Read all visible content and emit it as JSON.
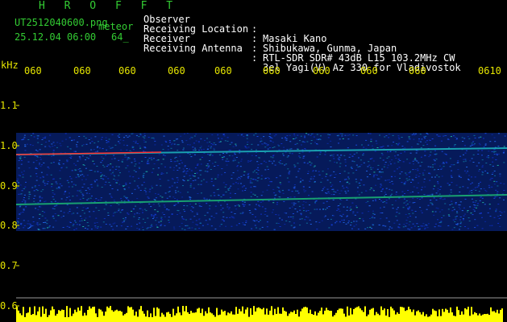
{
  "header": {
    "station_code": "H R O F F T",
    "filename": "UT2512040600.png",
    "mode": "meteor",
    "datetime": "25.12.04 06:00",
    "count": "64_"
  },
  "info": [
    {
      "label": "Observer",
      "sep": ":",
      "value": "Masaki Kano"
    },
    {
      "label": "Receiving Location",
      "sep": ":",
      "value": "Shibukawa, Gunma, Japan"
    },
    {
      "label": "Receiver",
      "sep": ":",
      "value": "RTL-SDR SDR# 43dB L15 103.2MHz CW"
    },
    {
      "label": "Receiving Antenna",
      "sep": ":",
      "value": "3el Yagi(V) Az 330 for Vladivostok"
    }
  ],
  "spectrogram": {
    "unit": "kHz",
    "time_labels": [
      "060",
      "060",
      "060",
      "060",
      "060",
      "060",
      "060",
      "060",
      "060",
      "0610"
    ],
    "freq_labels": [
      "1.1",
      "1.0",
      "0.9",
      "0.8",
      "0.7",
      "0.6"
    ],
    "colors": {
      "noise": "#1030c0",
      "strong": "#00ffff",
      "hot": "#ff3030",
      "level": "#ffff00"
    }
  }
}
